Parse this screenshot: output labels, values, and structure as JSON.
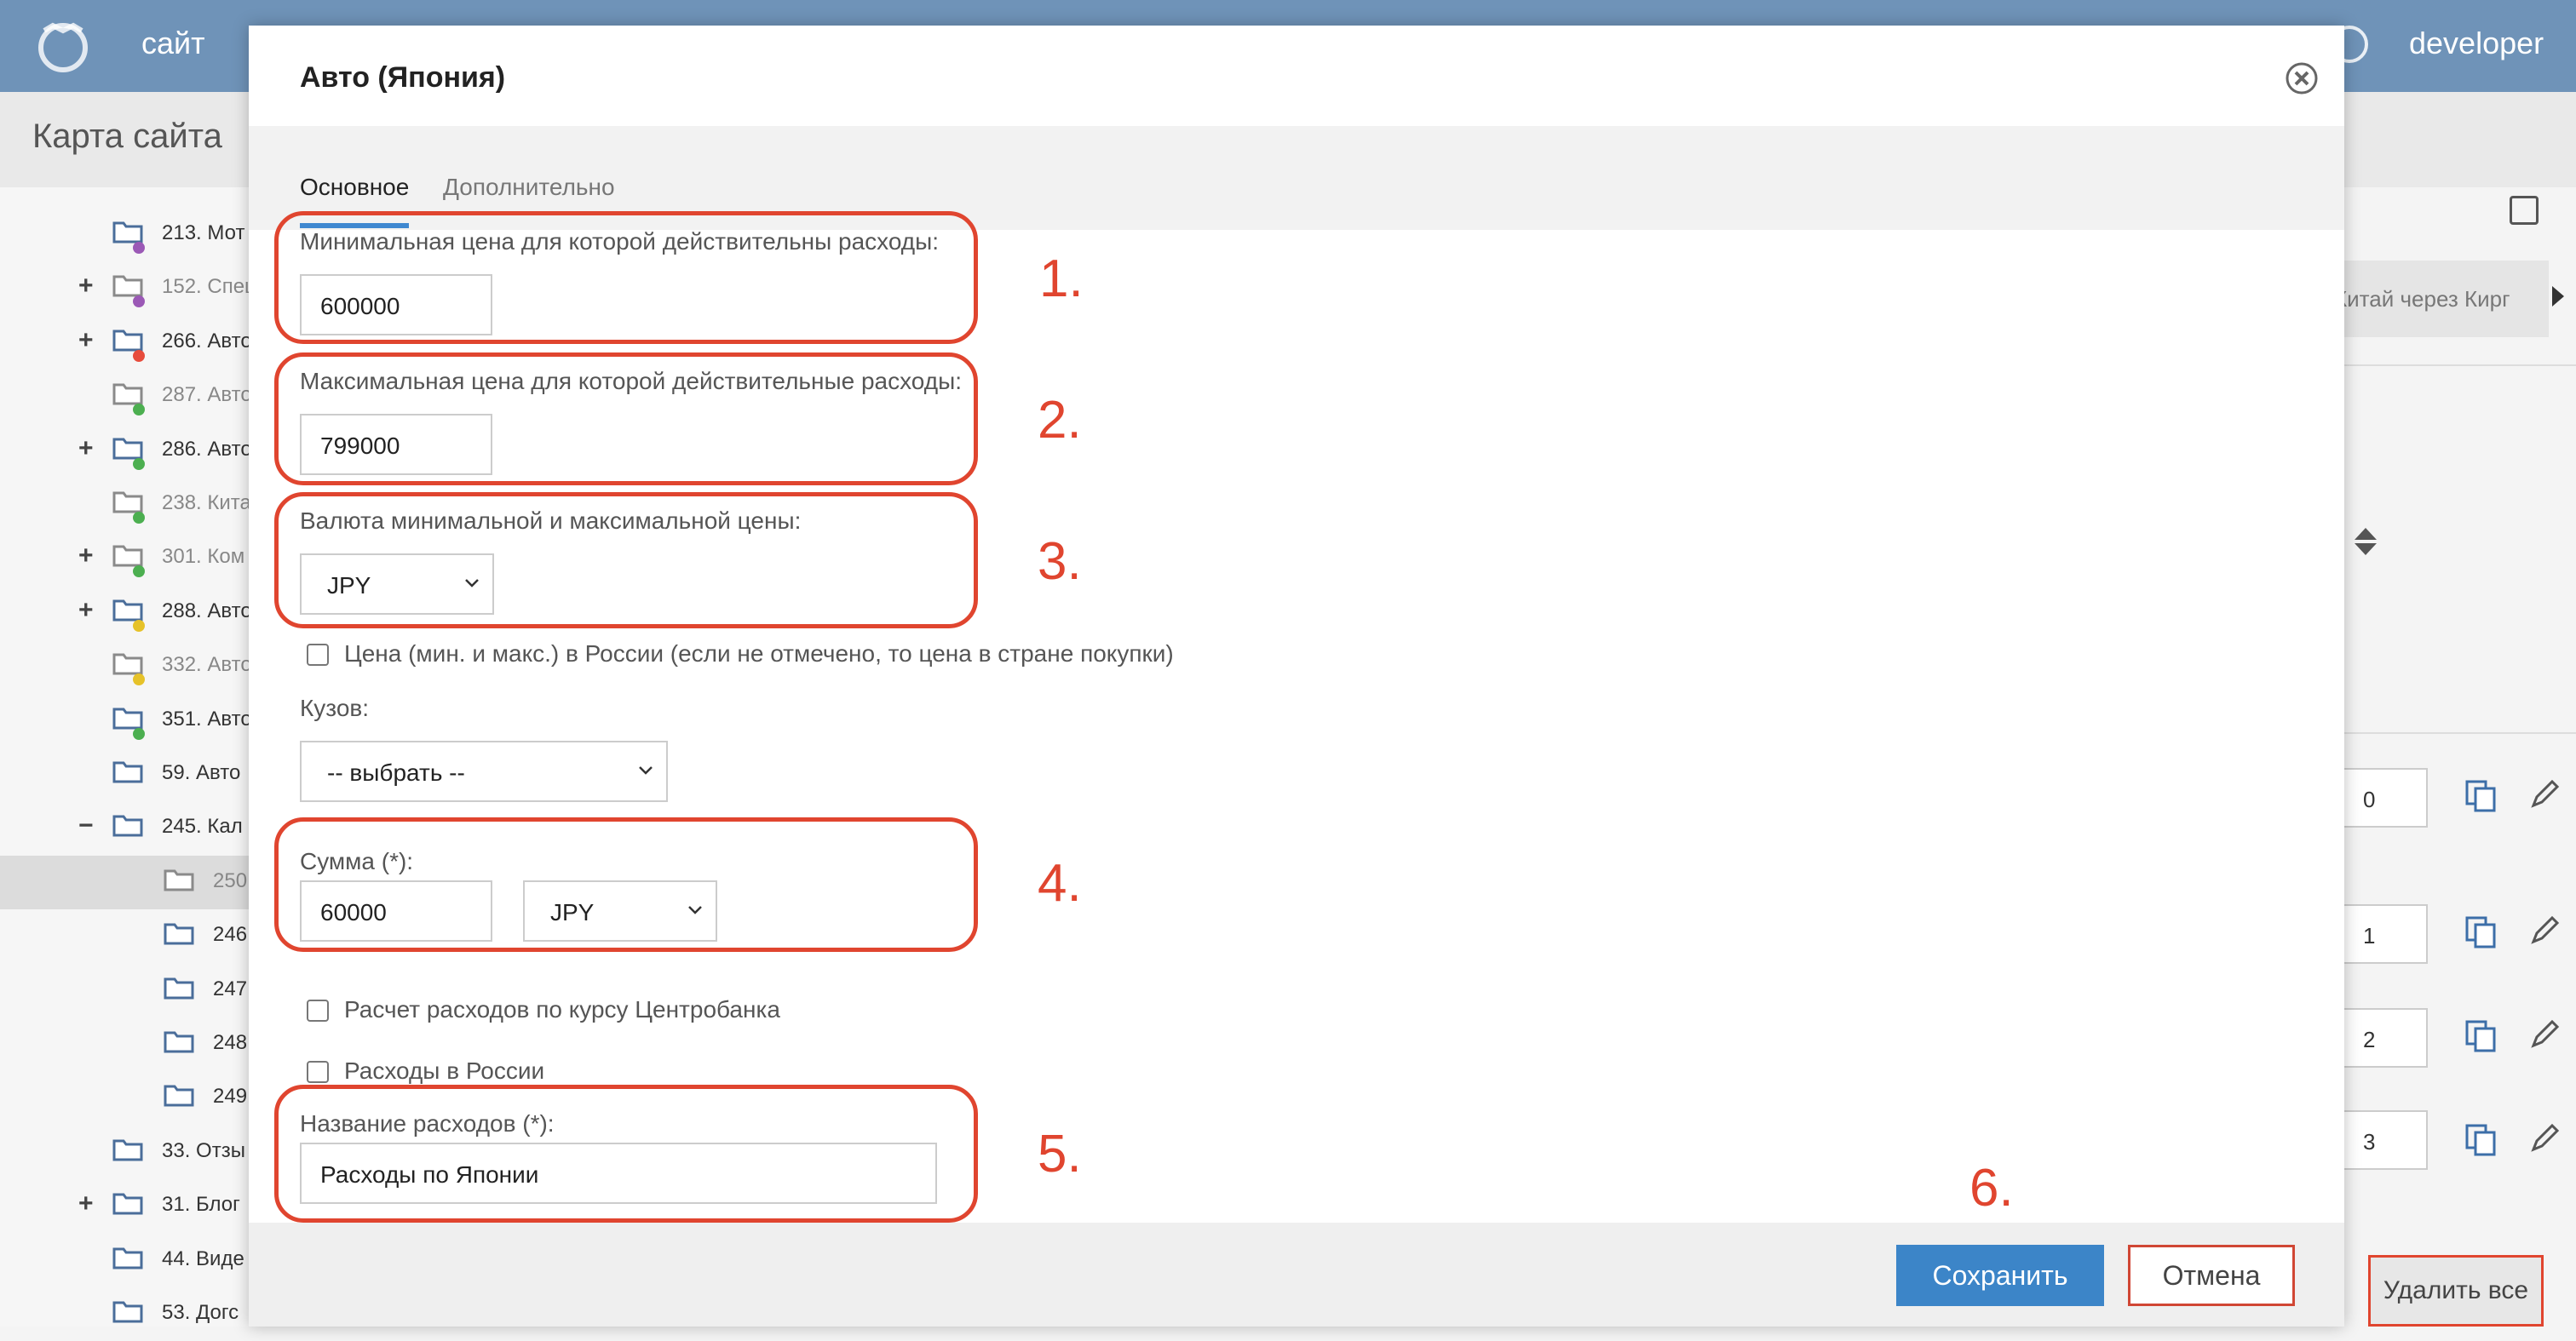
{
  "topbar": {
    "site_link": "сайт",
    "user_name": "developer",
    "color": "#6f93b8"
  },
  "page": {
    "title": "Карта сайта"
  },
  "tree": {
    "items": [
      {
        "label": "213. Мот",
        "toggle": "",
        "dot": "#9b59b6",
        "dim": false
      },
      {
        "label": "152. Спец",
        "toggle": "+",
        "dot": "#9b59b6",
        "dim": true
      },
      {
        "label": "266. Авто",
        "toggle": "+",
        "dot": "#e74c3c",
        "dim": false
      },
      {
        "label": "287. Авто",
        "toggle": "",
        "dot": "#4caf50",
        "dim": true
      },
      {
        "label": "286. Авто",
        "toggle": "+",
        "dot": "#4caf50",
        "dim": false
      },
      {
        "label": "238. Кита",
        "toggle": "",
        "dot": "#4caf50",
        "dim": true
      },
      {
        "label": "301. Ком",
        "toggle": "+",
        "dot": "#4caf50",
        "dim": true
      },
      {
        "label": "288. Авто",
        "toggle": "+",
        "dot": "#e6c229",
        "dim": false
      },
      {
        "label": "332. Авто",
        "toggle": "",
        "dot": "#e6c229",
        "dim": true
      },
      {
        "label": "351. Авто",
        "toggle": "",
        "dot": "#4caf50",
        "dim": false
      },
      {
        "label": "59. Авто",
        "toggle": "",
        "dot": "",
        "dim": false
      },
      {
        "label": "245. Кал",
        "toggle": "−",
        "dot": "",
        "dim": false
      },
      {
        "label": "250",
        "toggle": "",
        "dot": "",
        "dim": true
      },
      {
        "label": "246",
        "toggle": "",
        "dot": "",
        "dim": false
      },
      {
        "label": "247",
        "toggle": "",
        "dot": "",
        "dim": false
      },
      {
        "label": "248",
        "toggle": "",
        "dot": "",
        "dim": false
      },
      {
        "label": "249",
        "toggle": "",
        "dot": "",
        "dim": false
      },
      {
        "label": "33. Отзы",
        "toggle": "",
        "dot": "",
        "dim": false
      },
      {
        "label": "31. Блог",
        "toggle": "+",
        "dot": "",
        "dim": false
      },
      {
        "label": "44. Виде",
        "toggle": "",
        "dot": "",
        "dim": false
      },
      {
        "label": "53. Догс",
        "toggle": "",
        "dot": "",
        "dim": false
      }
    ]
  },
  "right_panel": {
    "route_text": "Китай через Кирг",
    "order_values": [
      "0",
      "1",
      "2",
      "3"
    ],
    "delete_all": "Удалить все"
  },
  "modal": {
    "title": "Авто (Япония)",
    "tabs": [
      {
        "label": "Основное",
        "active": true
      },
      {
        "label": "Дополнительно",
        "active": false
      }
    ],
    "min_price": {
      "label": "Минимальная цена для которой действительны расходы:",
      "value": "600000"
    },
    "max_price": {
      "label": "Максимальная цена для которой действительные расходы:",
      "value": "799000"
    },
    "currency": {
      "label": "Валюта минимальной и максимальной цены:",
      "value": "JPY"
    },
    "price_in_russia": {
      "label": "Цена (мин. и макс.) в России (если не отмечено, то цена в стране покупки)",
      "checked": false
    },
    "body": {
      "label": "Кузов:",
      "value": "-- выбрать --"
    },
    "amount": {
      "label": "Сумма (*):",
      "value": "60000",
      "currency": "JPY"
    },
    "cb_rate": {
      "label": "Расчет расходов по курсу Центробанка",
      "checked": false
    },
    "expenses_russia": {
      "label": "Расходы в России",
      "checked": false
    },
    "expense_name": {
      "label": "Название расходов (*):",
      "value": "Расходы по Японии"
    },
    "save_label": "Сохранить",
    "cancel_label": "Отмена",
    "accent_color": "#3c85c8"
  },
  "annotations": {
    "color": "#e0452f",
    "numbers": [
      "1.",
      "2.",
      "3.",
      "4.",
      "5.",
      "6."
    ]
  }
}
